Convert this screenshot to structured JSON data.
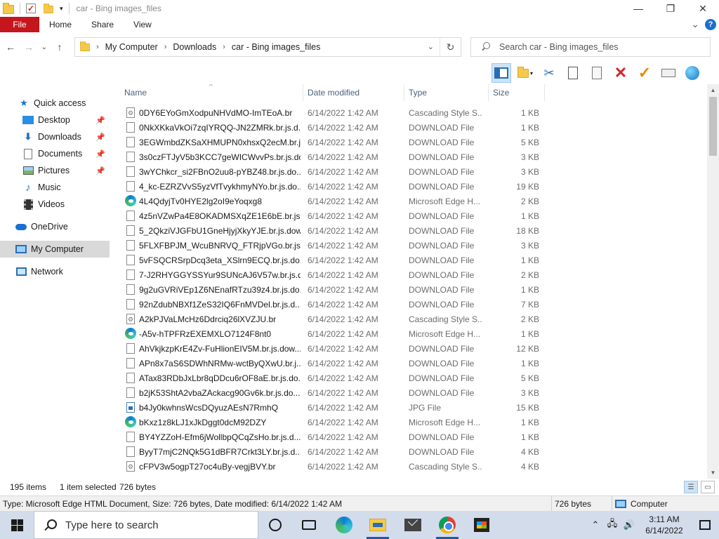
{
  "window": {
    "title": "car - Bing images_files",
    "controls": {
      "minimize": "—",
      "maximize": "❐",
      "close": "✕"
    }
  },
  "ribbon": {
    "tabs": [
      "File",
      "Home",
      "Share",
      "View"
    ],
    "help": "?",
    "expand": "⌄"
  },
  "address": {
    "crumbs": [
      "My Computer",
      "Downloads",
      "car - Bing images_files"
    ],
    "search_placeholder": "Search car - Bing images_files"
  },
  "nav": {
    "items": [
      {
        "label": "Quick access",
        "icon": "star-icon",
        "pinned": false
      },
      {
        "label": "Desktop",
        "icon": "desktop-icon",
        "pinned": true
      },
      {
        "label": "Downloads",
        "icon": "download-icon",
        "pinned": true
      },
      {
        "label": "Documents",
        "icon": "documents-icon",
        "pinned": true
      },
      {
        "label": "Pictures",
        "icon": "pictures-icon",
        "pinned": true
      },
      {
        "label": "Music",
        "icon": "music-icon",
        "pinned": false
      },
      {
        "label": "Videos",
        "icon": "videos-icon",
        "pinned": false
      },
      {
        "label": "OneDrive",
        "icon": "cloud-icon",
        "pinned": false
      },
      {
        "label": "My Computer",
        "icon": "computer-icon",
        "pinned": false,
        "selected": true
      },
      {
        "label": "Network",
        "icon": "network-icon",
        "pinned": false
      }
    ]
  },
  "columns": {
    "name": "Name",
    "date": "Date modified",
    "type": "Type",
    "size": "Size"
  },
  "files": [
    {
      "name": "0DY6EYoGmXodpuNHVdMO-ImTEoA.br",
      "date": "6/14/2022 1:42 AM",
      "type": "Cascading Style S...",
      "size": "1 KB",
      "icon": "css"
    },
    {
      "name": "0NkXKkaVkOi7zqIYRQQ-JN2ZMRk.br.js.d...",
      "date": "6/14/2022 1:42 AM",
      "type": "DOWNLOAD File",
      "size": "1 KB",
      "icon": "doc"
    },
    {
      "name": "3EGWmbdZKSaXHMUPN0xhsxQ2ecM.br.js...",
      "date": "6/14/2022 1:42 AM",
      "type": "DOWNLOAD File",
      "size": "5 KB",
      "icon": "doc"
    },
    {
      "name": "3s0czFTJyV5b3KCC7geWICWvvPs.br.js.do...",
      "date": "6/14/2022 1:42 AM",
      "type": "DOWNLOAD File",
      "size": "3 KB",
      "icon": "doc"
    },
    {
      "name": "3wYChkcr_si2FBnO2uu8-pYBZ48.br.js.do...",
      "date": "6/14/2022 1:42 AM",
      "type": "DOWNLOAD File",
      "size": "3 KB",
      "icon": "doc"
    },
    {
      "name": "4_kc-EZRZVvS5yzVfTvykhmyNYo.br.js.do...",
      "date": "6/14/2022 1:42 AM",
      "type": "DOWNLOAD File",
      "size": "19 KB",
      "icon": "doc"
    },
    {
      "name": "4L4QdyjTv0HYE2lg2oI9eYoqxg8",
      "date": "6/14/2022 1:42 AM",
      "type": "Microsoft Edge H...",
      "size": "2 KB",
      "icon": "edge"
    },
    {
      "name": "4z5nVZwPa4E8OKADMSXqZE1E6bE.br.js....",
      "date": "6/14/2022 1:42 AM",
      "type": "DOWNLOAD File",
      "size": "1 KB",
      "icon": "doc"
    },
    {
      "name": "5_2QkziVJGFbU1GneHjyjXkyYJE.br.js.dow...",
      "date": "6/14/2022 1:42 AM",
      "type": "DOWNLOAD File",
      "size": "18 KB",
      "icon": "doc"
    },
    {
      "name": "5FLXFBPJM_WcuBNRVQ_FTRjpVGo.br.js....",
      "date": "6/14/2022 1:42 AM",
      "type": "DOWNLOAD File",
      "size": "3 KB",
      "icon": "doc"
    },
    {
      "name": "5vFSQCRSrpDcq3eta_XSlrn9ECQ.br.js.do...",
      "date": "6/14/2022 1:42 AM",
      "type": "DOWNLOAD File",
      "size": "1 KB",
      "icon": "doc"
    },
    {
      "name": "7-J2RHYGGYSSYur9SUNcAJ6V57w.br.js.d...",
      "date": "6/14/2022 1:42 AM",
      "type": "DOWNLOAD File",
      "size": "2 KB",
      "icon": "doc"
    },
    {
      "name": "9g2uGVRiVEp1Z6NEnafRTzu39z4.br.js.do...",
      "date": "6/14/2022 1:42 AM",
      "type": "DOWNLOAD File",
      "size": "1 KB",
      "icon": "doc"
    },
    {
      "name": "92nZdubNBXf1ZeS32IQ6FnMVDel.br.js.d...",
      "date": "6/14/2022 1:42 AM",
      "type": "DOWNLOAD File",
      "size": "7 KB",
      "icon": "doc"
    },
    {
      "name": "A2kPJVaLMcHz6Ddrciq26lXVZJU.br",
      "date": "6/14/2022 1:42 AM",
      "type": "Cascading Style S...",
      "size": "2 KB",
      "icon": "css"
    },
    {
      "name": "-A5v-hTPFRzEXEMXLO7124F8nt0",
      "date": "6/14/2022 1:42 AM",
      "type": "Microsoft Edge H...",
      "size": "1 KB",
      "icon": "edge"
    },
    {
      "name": "AhVkjkzpKrE4Zv-FuHlionEIV5M.br.js.dow...",
      "date": "6/14/2022 1:42 AM",
      "type": "DOWNLOAD File",
      "size": "12 KB",
      "icon": "doc"
    },
    {
      "name": "APn8x7aS6SDWhNRMw-wctByQXwU.br.j...",
      "date": "6/14/2022 1:42 AM",
      "type": "DOWNLOAD File",
      "size": "1 KB",
      "icon": "doc"
    },
    {
      "name": "ATax83RDbJxLbr8qDDcu6rOF8aE.br.js.do...",
      "date": "6/14/2022 1:42 AM",
      "type": "DOWNLOAD File",
      "size": "5 KB",
      "icon": "doc"
    },
    {
      "name": "b2jK53ShtA2vbaZAckacg90Gv6k.br.js.do...",
      "date": "6/14/2022 1:42 AM",
      "type": "DOWNLOAD File",
      "size": "3 KB",
      "icon": "doc"
    },
    {
      "name": "b4Jy0kwhnsWcsDQyuzAEsN7RmhQ",
      "date": "6/14/2022 1:42 AM",
      "type": "JPG File",
      "size": "15 KB",
      "icon": "jpg"
    },
    {
      "name": "bKxz1z8kLJ1xJkDggt0dcM92DZY",
      "date": "6/14/2022 1:42 AM",
      "type": "Microsoft Edge H...",
      "size": "1 KB",
      "icon": "edge"
    },
    {
      "name": "BY4YZZoH-Efm6jWollbpQCqZsHo.br.js.d...",
      "date": "6/14/2022 1:42 AM",
      "type": "DOWNLOAD File",
      "size": "1 KB",
      "icon": "doc"
    },
    {
      "name": "ByyT7mjC2NQk5G1dBFR7Crkt3LY.br.js.d...",
      "date": "6/14/2022 1:42 AM",
      "type": "DOWNLOAD File",
      "size": "4 KB",
      "icon": "doc"
    },
    {
      "name": "cFPV3w5ogpT27oc4uBy-vegjBVY.br",
      "date": "6/14/2022 1:42 AM",
      "type": "Cascading Style S...",
      "size": "4 KB",
      "icon": "css"
    }
  ],
  "status": {
    "count": "195 items",
    "selected": "1 item selected",
    "selected_size": "726 bytes"
  },
  "details": {
    "text": "Type: Microsoft Edge HTML Document, Size: 726 bytes, Date modified: 6/14/2022 1:42 AM",
    "size": "726 bytes",
    "location": "Computer"
  },
  "taskbar": {
    "search_placeholder": "Type here to search",
    "time": "3:11 AM",
    "date": "6/14/2022"
  }
}
